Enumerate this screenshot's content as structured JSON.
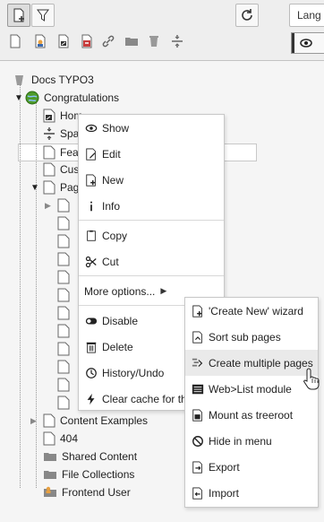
{
  "toolbar": {
    "language_label": "Lang",
    "row1": [
      {
        "name": "new-page-drag-icon"
      },
      {
        "name": "filter-icon"
      },
      {
        "name": "refresh-icon"
      }
    ],
    "row2": [
      {
        "name": "new-page-icon"
      },
      {
        "name": "backend-user-page-icon"
      },
      {
        "name": "shortcut-page-icon"
      },
      {
        "name": "mountpoint-page-icon"
      },
      {
        "name": "link-page-icon"
      },
      {
        "name": "folder-icon"
      },
      {
        "name": "recycler-icon"
      },
      {
        "name": "spacer-icon"
      }
    ]
  },
  "tree": {
    "root": "Docs TYPO3",
    "site": "Congratulations",
    "items": [
      {
        "label": "Hom",
        "icon": "shortcut-page-icon"
      },
      {
        "label": "Spa",
        "icon": "spacer-icon"
      },
      {
        "label": "Fea",
        "icon": "page-icon"
      },
      {
        "label": "Cus",
        "icon": "page-icon"
      },
      {
        "label": "Pag",
        "icon": "page-icon"
      }
    ],
    "bottom_items": [
      {
        "label": "Content Examples",
        "icon": "page-icon"
      },
      {
        "label": "404",
        "icon": "page-icon"
      },
      {
        "label": "Shared Content",
        "icon": "folder-icon"
      },
      {
        "label": "File Collections",
        "icon": "folder-icon"
      },
      {
        "label": "Frontend User",
        "icon": "user-folder-icon"
      }
    ]
  },
  "context_menu": {
    "items": [
      {
        "label": "Show",
        "icon": "eye-icon"
      },
      {
        "label": "Edit",
        "icon": "edit-icon"
      },
      {
        "label": "New",
        "icon": "new-icon"
      },
      {
        "label": "Info",
        "icon": "info-icon"
      },
      {
        "label": "Copy",
        "icon": "copy-icon"
      },
      {
        "label": "Cut",
        "icon": "cut-icon"
      },
      {
        "label": "More options...",
        "icon": "chevron-right-icon"
      },
      {
        "label": "Disable",
        "icon": "toggle-icon"
      },
      {
        "label": "Delete",
        "icon": "trash-icon"
      },
      {
        "label": "History/Undo",
        "icon": "history-icon"
      },
      {
        "label": "Clear cache for th",
        "icon": "flash-icon"
      }
    ]
  },
  "submenu": {
    "items": [
      {
        "label": "'Create New' wizard",
        "icon": "new-wizard-icon"
      },
      {
        "label": "Sort sub pages",
        "icon": "sort-icon"
      },
      {
        "label": "Create multiple pages",
        "icon": "create-multiple-icon"
      },
      {
        "label": "Web>List module",
        "icon": "list-icon"
      },
      {
        "label": "Mount as treeroot",
        "icon": "mount-icon"
      },
      {
        "label": "Hide in menu",
        "icon": "hide-icon"
      },
      {
        "label": "Export",
        "icon": "export-icon"
      },
      {
        "label": "Import",
        "icon": "import-icon"
      }
    ]
  }
}
